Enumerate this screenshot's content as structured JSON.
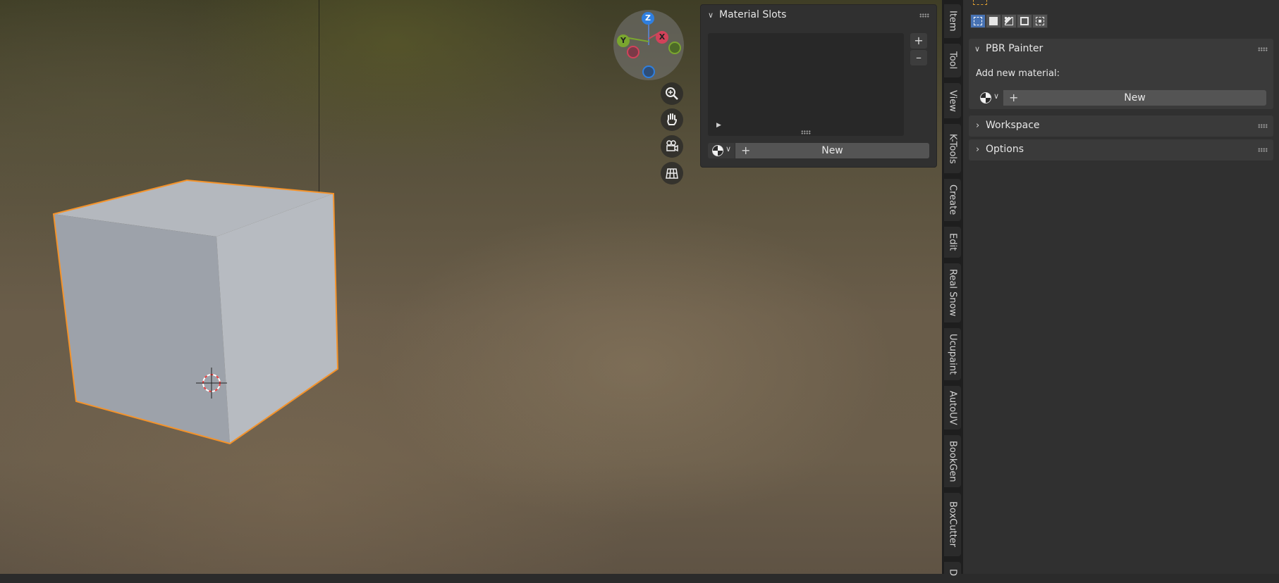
{
  "viewport": {
    "gizmo": {
      "z_label": "Z",
      "x_label": "X",
      "y_label": "Y"
    },
    "nav_icons": [
      "zoom-icon",
      "pan-hand-icon",
      "camera-icon",
      "grid-ortho-icon"
    ],
    "colors": {
      "selection_outline": "#f4932b",
      "z_axis": "#2f7fe0",
      "x_axis": "#d2425a",
      "y_axis": "#7aa62f"
    }
  },
  "material_panel": {
    "title": "Material Slots",
    "add_label": "+",
    "remove_label": "–",
    "new_button": "New",
    "play_glyph": "▶"
  },
  "tabs": [
    "Item",
    "Tool",
    "View",
    "K-Tools",
    "Create",
    "Edit",
    "Real Snow",
    "Ucupaint",
    "AutoUV",
    "BookGen",
    "BoxCutter",
    "D"
  ],
  "sidebar": {
    "select_modes": [
      "set",
      "extend",
      "subtract",
      "invert",
      "intersect"
    ],
    "pbr_painter": {
      "title": "PBR Painter",
      "add_label": "Add new material:",
      "new_button": "New"
    },
    "workspace": {
      "title": "Workspace"
    },
    "options": {
      "title": "Options"
    }
  }
}
